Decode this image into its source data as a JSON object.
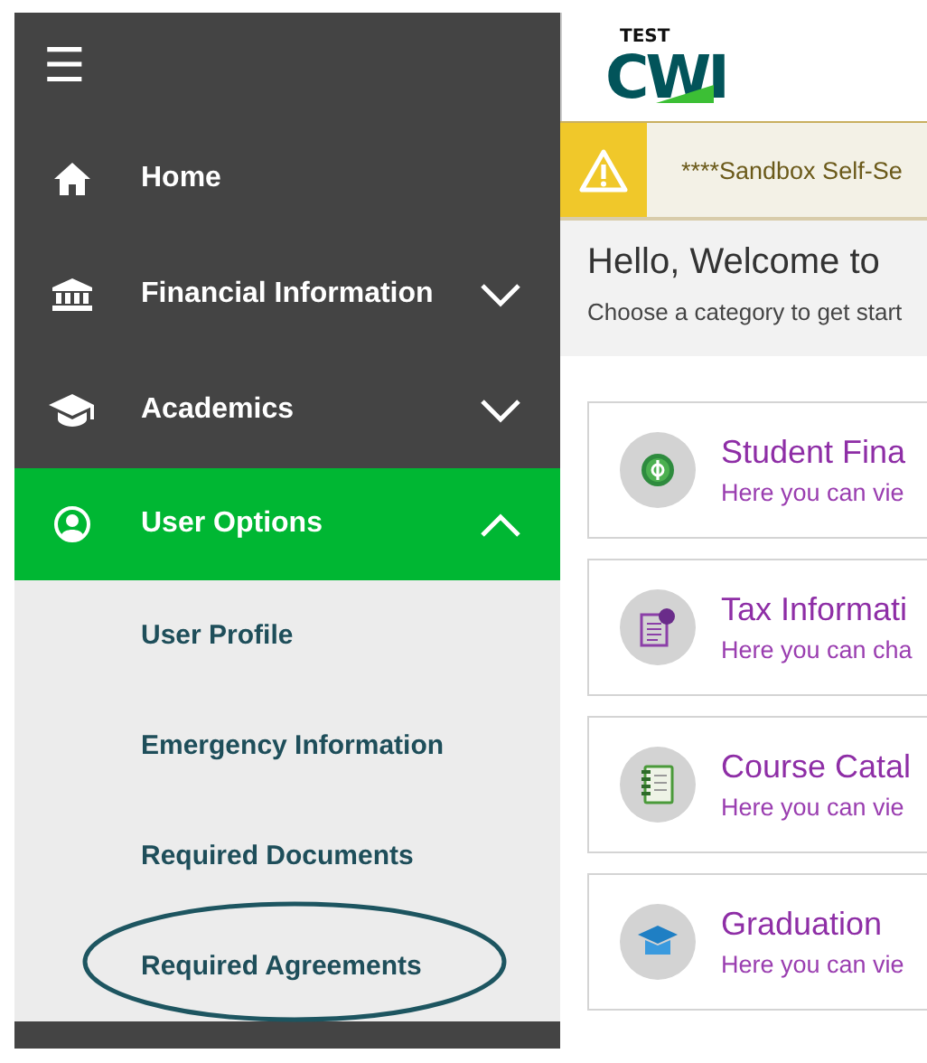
{
  "menu_button": {
    "label": "☰"
  },
  "sidebar": {
    "items": [
      {
        "label": "Home",
        "selected": false
      },
      {
        "label": "Financial Information",
        "selected": false,
        "expanded": false
      },
      {
        "label": "Academics",
        "selected": false,
        "expanded": false
      },
      {
        "label": "User Options",
        "selected": true,
        "expanded": true,
        "children": [
          {
            "label": "User Profile",
            "highlighted": false
          },
          {
            "label": "Emergency Information",
            "highlighted": false
          },
          {
            "label": "Required Documents",
            "highlighted": false
          },
          {
            "label": "Required Agreements",
            "highlighted": true
          }
        ]
      }
    ]
  },
  "logo": {
    "top": "TEST",
    "main": "CWI"
  },
  "banner": {
    "text": "****Sandbox Self-Se"
  },
  "welcome": {
    "title": "Hello, Welcome to",
    "subtitle": "Choose a category to get start"
  },
  "cards": [
    {
      "title": "Student Fina",
      "description": "Here you can vie"
    },
    {
      "title": "Tax Informati",
      "description": "Here you can cha"
    },
    {
      "title": "Course Catal",
      "description": "Here you can vie"
    },
    {
      "title": "Graduation",
      "description": "Here you can vie"
    }
  ]
}
